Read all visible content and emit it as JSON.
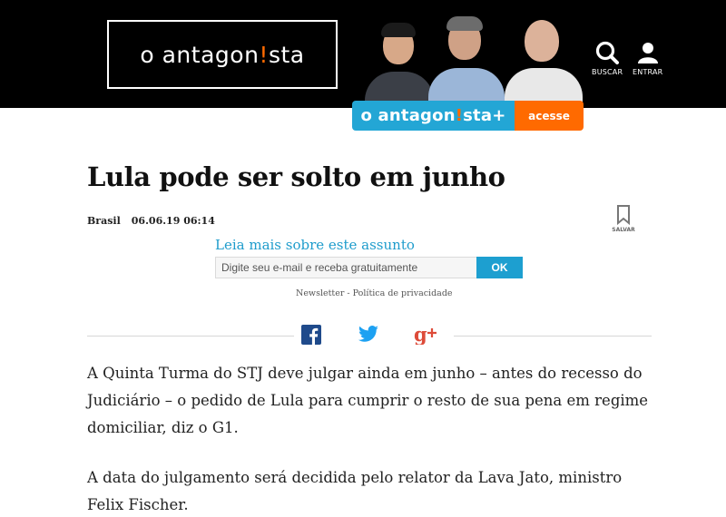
{
  "header": {
    "logo": {
      "text_pre": "o antagon",
      "text_accent": "!",
      "text_post": "sta"
    },
    "nav": {
      "search_label": "BUSCAR",
      "login_label": "ENTRAR"
    },
    "plus_banner": {
      "brand_pre": "o antagon",
      "brand_accent": "!",
      "brand_post": "sta+",
      "cta_label": "acesse"
    }
  },
  "article": {
    "title": "Lula pode ser solto em junho",
    "category": "Brasil",
    "date": "06.06.19 06:14",
    "save_label": "SALVAR",
    "paragraphs": [
      "A Quinta Turma do STJ deve julgar ainda em junho – antes do recesso do Judiciário – o pedido de Lula para cumprir o resto de sua pena em regime domiciliar, diz o G1.",
      "A data do julgamento será decidida pelo relator da Lava Jato, ministro Felix Fischer."
    ]
  },
  "newsletter": {
    "heading": "Leia mais sobre este assunto",
    "placeholder": "Digite seu e-mail e receba gratuitamente",
    "button_label": "OK",
    "links": "Newsletter - Política de privacidade"
  },
  "share": {
    "icons": [
      "facebook-icon",
      "twitter-icon",
      "google-plus-icon"
    ]
  },
  "colors": {
    "accent_blue": "#23a6d5",
    "accent_orange": "#ff6a00",
    "header_bg": "#000000",
    "link_blue": "#1e9ccc"
  }
}
